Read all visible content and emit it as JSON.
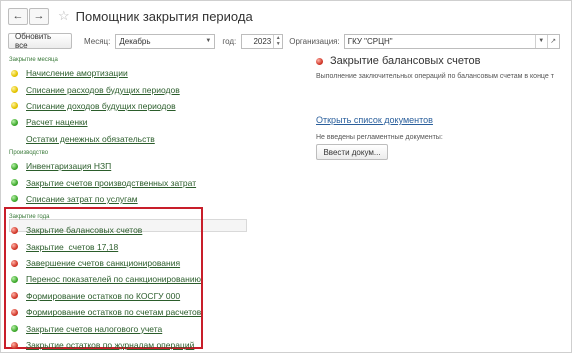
{
  "window": {
    "title": "Помощник закрытия периода"
  },
  "toolbar": {
    "refresh_label": "Обновить все",
    "month_label": "Месяц:",
    "month_value": "Декабрь",
    "year_label": "год:",
    "year_value": "2023",
    "org_label": "Организация:",
    "org_value": "ГКУ \"СРЦН\""
  },
  "sections": [
    {
      "title": "Закрытие месяца",
      "items": [
        {
          "label": "Начисление амортизации",
          "status": "yellow"
        },
        {
          "label": "Списание расходов будущих периодов",
          "status": "yellow"
        },
        {
          "label": "Списание доходов будущих периодов",
          "status": "yellow"
        },
        {
          "label": "Расчет наценки",
          "status": "green"
        },
        {
          "label": "Остатки денежных обязательств",
          "status": "none"
        }
      ]
    },
    {
      "title": "Производство",
      "items": [
        {
          "label": "Инвентаризация НЗП",
          "status": "green"
        },
        {
          "label": "Закрытие счетов производственных затрат",
          "status": "green"
        },
        {
          "label": "Списание затрат по услугам",
          "status": "green"
        }
      ]
    },
    {
      "title": "Закрытие года",
      "items": [
        {
          "label": "Закрытие балансовых счетов",
          "status": "red"
        },
        {
          "label": "Закрытие  счетов 17,18",
          "status": "red"
        },
        {
          "label": "Завершение счетов санкционирования",
          "status": "red"
        },
        {
          "label": "Перенос показателей по санкционированию",
          "status": "green"
        },
        {
          "label": "Формирование остатков по КОСГУ 000",
          "status": "red"
        },
        {
          "label": "Формирование остатков по счетам расчетов",
          "status": "red"
        },
        {
          "label": "Закрытие счетов налогового учета",
          "status": "green"
        },
        {
          "label": "Закрытие остатков по журналам операций",
          "status": "red"
        }
      ]
    }
  ],
  "detail": {
    "title": "Закрытие балансовых счетов",
    "status": "red",
    "description": "Выполнение заключительных операций по балансовым счетам в конце т",
    "open_docs_link": "Открыть список документов",
    "note": "Не введены регламентные документы:",
    "enter_button": "Ввести докум..."
  },
  "colors": {
    "accent_red": "#c81e2a",
    "link_green": "#2b5d2b",
    "link_blue": "#2a5f9c"
  }
}
